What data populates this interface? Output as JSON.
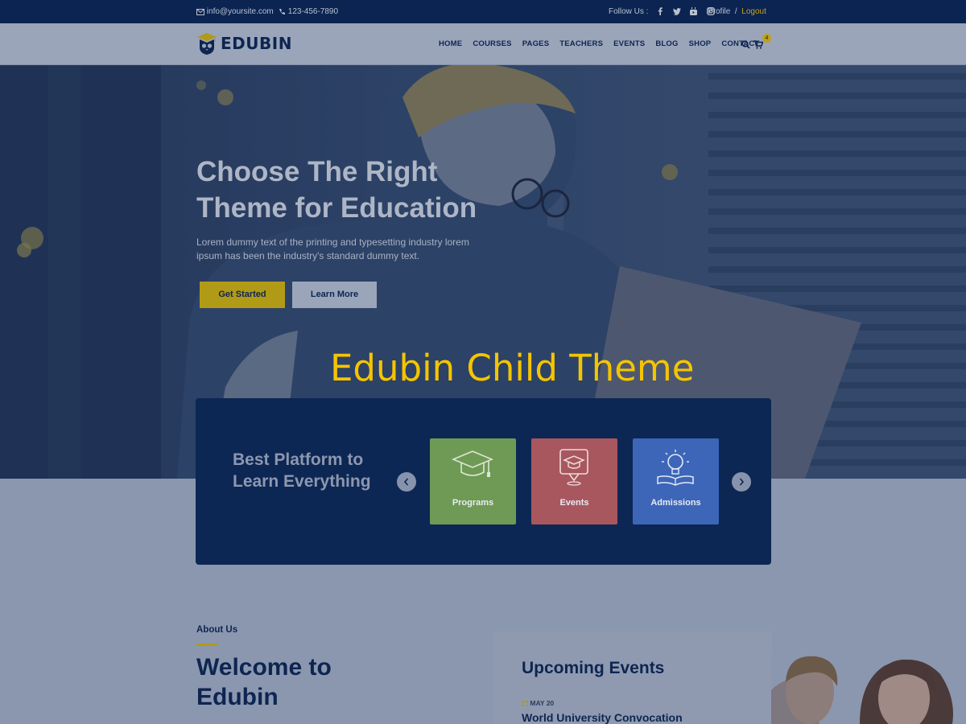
{
  "topbar": {
    "email": "info@yoursite.com",
    "phone": "123-456-7890",
    "follow_label": "Follow Us :",
    "social_icons": [
      "facebook-icon",
      "twitter-icon",
      "youtube-icon",
      "instagram-icon"
    ],
    "profile": "Profile",
    "separator": "/",
    "logout": "Logout"
  },
  "header": {
    "logo": "EDUBIN",
    "nav": [
      "HOME",
      "COURSES",
      "PAGES",
      "TEACHERS",
      "EVENTS",
      "BLOG",
      "SHOP",
      "CONTACT"
    ],
    "cart_count": "4"
  },
  "hero": {
    "title": "Choose The Right Theme for Education",
    "text": "Lorem dummy text of the printing and typesetting industry lorem ipsum has been the industry's standard dummy text.",
    "btn_primary": "Get Started",
    "btn_secondary": "Learn More"
  },
  "overlay_title": "Edubin Child Theme",
  "platform": {
    "title": "Best Platform to Learn Everything",
    "tiles": [
      {
        "label": "Programs",
        "icon": "graduation-cap-icon",
        "color": "#6f9a55"
      },
      {
        "label": "Events",
        "icon": "event-badge-icon",
        "color": "#a8575e"
      },
      {
        "label": "Admissions",
        "icon": "lightbulb-book-icon",
        "color": "#3d66b8"
      }
    ]
  },
  "about": {
    "label": "About Us",
    "title": "Welcome to Edubin"
  },
  "events": {
    "title": "Upcoming Events",
    "date": "MAY 20",
    "name": "World University Convocation"
  },
  "colors": {
    "navy": "#0e2551",
    "gold": "#b19a16",
    "overlay": "#f5c400"
  }
}
